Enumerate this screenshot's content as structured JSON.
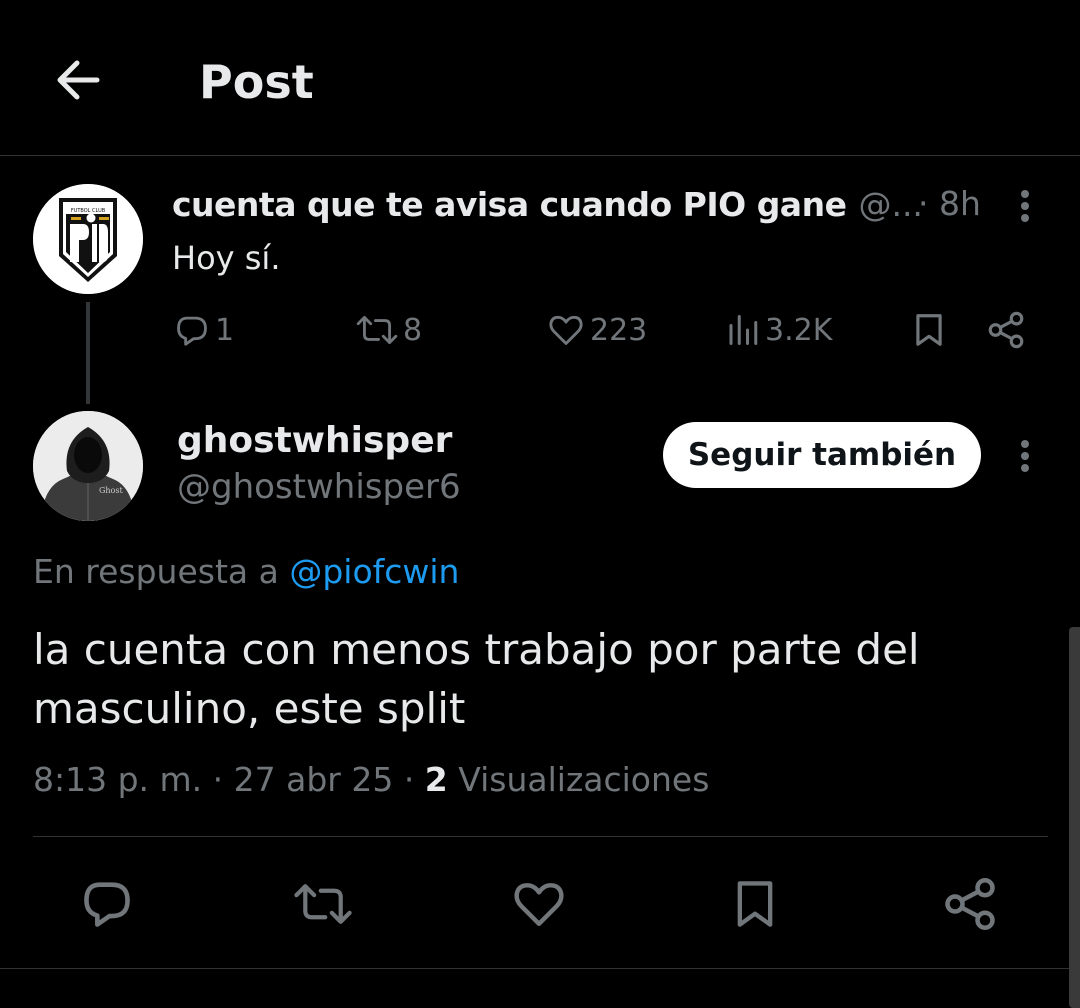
{
  "header": {
    "title": "Post",
    "back_icon": "arrow-left-icon"
  },
  "parent_post": {
    "author_name": "cuenta que te avisa cuando PIO gane",
    "author_handle": "@...",
    "time": "· 8h",
    "text": "Hoy sí.",
    "avatar_text": "PIO",
    "actions": {
      "replies": "1",
      "reposts": "8",
      "likes": "223",
      "views": "3.2K"
    }
  },
  "reply_post": {
    "author_name": "ghostwhisper",
    "author_handle": "@ghostwhisper6",
    "follow_label": "Seguir también",
    "reply_to_prefix": "En respuesta a ",
    "reply_to_handle": "@piofcwin",
    "text": "la cuenta con menos trabajo por parte del masculino, este split",
    "timestamp": "8:13 p. m. · 27 abr 25 · ",
    "views_count": "2",
    "views_label": " Visualizaciones"
  },
  "colors": {
    "background": "#000000",
    "text_primary": "#e7e9ea",
    "text_secondary": "#71767b",
    "link": "#1d9bf0",
    "border": "#2f3336"
  }
}
